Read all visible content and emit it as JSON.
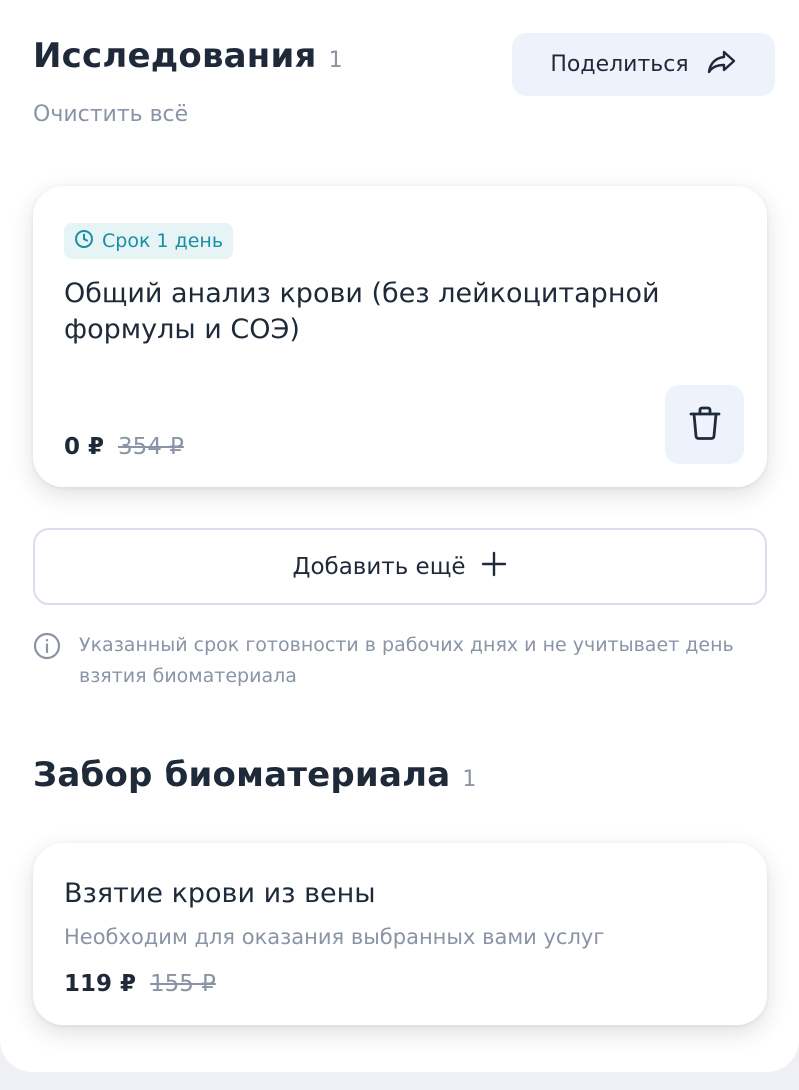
{
  "studies": {
    "title": "Исследования",
    "count": "1",
    "clear_all": "Очистить всё",
    "share_label": "Поделиться",
    "items": [
      {
        "term_badge": "Срок 1 день",
        "name": "Общий анализ крови (без лейкоцитарной формулы и СОЭ)",
        "price": "0 ₽",
        "old_price": "354 ₽"
      }
    ],
    "add_more_label": "Добавить ещё",
    "info_note": "Указанный срок готовности в рабочих днях и не учитывает день взятия биоматериала"
  },
  "biomaterial": {
    "title": "Забор биоматериала",
    "count": "1",
    "items": [
      {
        "name": "Взятие крови из вены",
        "description": "Необходим для оказания выбранных вами услуг",
        "price": "119 ₽",
        "old_price": "155 ₽"
      }
    ]
  },
  "colors": {
    "accent_teal": "#1a8fa3",
    "badge_bg": "#e6f4f6",
    "button_bg": "#eef2fb",
    "text_primary": "#1e2a3a",
    "text_muted": "#8a94a6"
  },
  "icons": {
    "share": "share-arrow-icon",
    "clock": "clock-icon",
    "trash": "trash-icon",
    "plus": "plus-icon",
    "info": "info-icon"
  }
}
